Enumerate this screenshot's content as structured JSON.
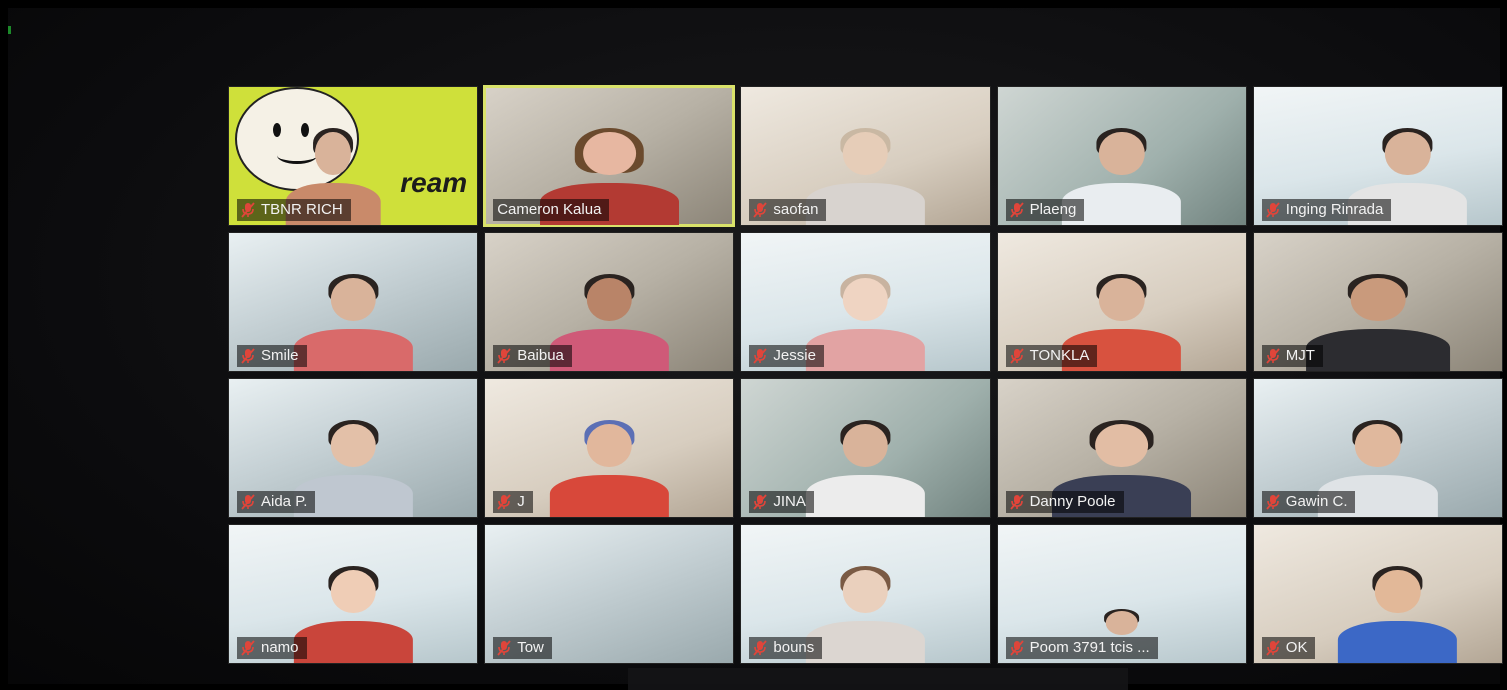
{
  "participants": [
    {
      "name": "TBNR RICH",
      "muted": true,
      "overlay_text": "ream"
    },
    {
      "name": "Cameron Kalua",
      "muted": false,
      "active_speaker": true
    },
    {
      "name": "saofan",
      "muted": true
    },
    {
      "name": "Plaeng",
      "muted": true
    },
    {
      "name": "Inging Rinrada",
      "muted": true
    },
    {
      "name": "Smile",
      "muted": true
    },
    {
      "name": "Baibua",
      "muted": true
    },
    {
      "name": "Jessie",
      "muted": true
    },
    {
      "name": "TONKLA",
      "muted": true
    },
    {
      "name": "MJT",
      "muted": true
    },
    {
      "name": "Aida P.",
      "muted": true
    },
    {
      "name": "J",
      "muted": true
    },
    {
      "name": "JINA",
      "muted": true
    },
    {
      "name": "Danny Poole",
      "muted": true
    },
    {
      "name": "Gawin C.",
      "muted": true
    },
    {
      "name": "namo",
      "muted": true
    },
    {
      "name": "Tow",
      "muted": true
    },
    {
      "name": "bouns",
      "muted": true
    },
    {
      "name": "Poom 3791 tcis ...",
      "muted": true
    },
    {
      "name": "OK",
      "muted": true
    }
  ],
  "icons": {
    "muted": "mic-muted-icon"
  },
  "colors": {
    "active_speaker_border": "#d9e26a",
    "mute_icon": "#e0453a",
    "name_label_bg": "rgba(0,0,0,0.55)"
  }
}
